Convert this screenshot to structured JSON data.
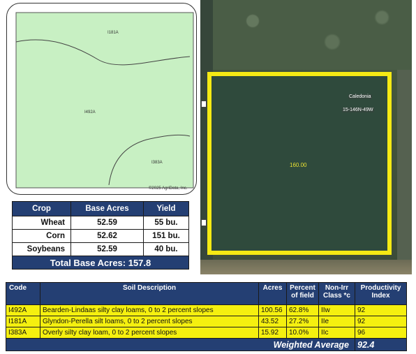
{
  "soil_map": {
    "labels": {
      "i181a": "I181A",
      "i492a": "I492A",
      "i383a": "I383A"
    },
    "copyright": "©2025 AgriData, Inc.",
    "fill_color": "#c8f0c3"
  },
  "crop_table": {
    "headers": {
      "crop": "Crop",
      "base_acres": "Base Acres",
      "yield": "Yield"
    },
    "rows": [
      {
        "crop": "Wheat",
        "base_acres": "52.59",
        "yield": "55 bu."
      },
      {
        "crop": "Corn",
        "base_acres": "52.62",
        "yield": "151 bu."
      },
      {
        "crop": "Soybeans",
        "base_acres": "52.59",
        "yield": "40 bu."
      }
    ],
    "total": "Total Base Acres:  157.8"
  },
  "aerial": {
    "acres": "160.00",
    "place": "Caledonia",
    "township": "15-146N-49W",
    "border_color": "#f5ea14"
  },
  "soil_table": {
    "headers": {
      "code": "Code",
      "description": "Soil Description",
      "acres": "Acres",
      "percent": "Percent of field",
      "class": "Non-Irr Class *c",
      "productivity": "Productivity Index"
    },
    "rows": [
      {
        "code": "I492A",
        "description": "Bearden-Lindaas silty clay loams, 0 to 2 percent slopes",
        "acres": "100.56",
        "percent": "62.8%",
        "class": "IIw",
        "productivity": "92"
      },
      {
        "code": "I181A",
        "description": "Glyndon-Perella silt loams, 0 to 2 percent slopes",
        "acres": "43.52",
        "percent": "27.2%",
        "class": "IIe",
        "productivity": "92"
      },
      {
        "code": "I383A",
        "description": "Overly silty clay loam, 0 to 2 percent slopes",
        "acres": "15.92",
        "percent": "10.0%",
        "class": "IIc",
        "productivity": "96"
      }
    ],
    "weighted_label": "Weighted Average",
    "weighted_value": "92.4"
  },
  "colors": {
    "header_navy": "#243f73",
    "row_yellow": "#f5f00f"
  }
}
